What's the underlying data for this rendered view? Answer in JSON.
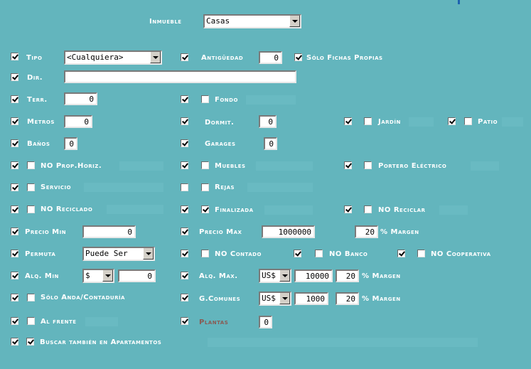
{
  "header": {
    "inmueble_label": "Inmueble",
    "inmueble_value": "Casas"
  },
  "tipo": {
    "label": "Tipo",
    "value": "<Cualquiera>"
  },
  "antiguedad": {
    "label": "Antigüedad",
    "value": "0"
  },
  "solo_fichas": {
    "label": "Sólo Fichas Propias"
  },
  "dir": {
    "label": "Dir.",
    "value": ""
  },
  "terr": {
    "label": "Terr.",
    "value": "0"
  },
  "fondo": {
    "label": "Fondo"
  },
  "metros": {
    "label": "Metros",
    "value": "0"
  },
  "dormit": {
    "label": "Dormit.",
    "value": "0"
  },
  "jardin": {
    "label": "Jardín"
  },
  "patio": {
    "label": "Patio"
  },
  "banos": {
    "label": "Baños",
    "value": "0"
  },
  "garages": {
    "label": "Garages",
    "value": "0"
  },
  "no_prop_horiz": {
    "label": "NO Prop.Horiz."
  },
  "muebles": {
    "label": "Muebles"
  },
  "portero": {
    "label": "Portero Eléctrico"
  },
  "servicio": {
    "label": "Servicio"
  },
  "rejas": {
    "label": "Rejas"
  },
  "no_reciclado": {
    "label": "NO Reciclado"
  },
  "finalizada": {
    "label": "Finalizada"
  },
  "no_reciclar": {
    "label": "NO Reciclar"
  },
  "precio_min": {
    "label": "Precio Min",
    "value": "0"
  },
  "precio_max": {
    "label": "Precio Max",
    "value": "1000000",
    "margen_value": "20",
    "margen_label": "% Margen"
  },
  "permuta": {
    "label": "Permuta",
    "value": "Puede Ser"
  },
  "no_contado": {
    "label": "NO Contado"
  },
  "no_banco": {
    "label": "NO Banco"
  },
  "no_cooperativa": {
    "label": "NO Cooperativa"
  },
  "alq_min": {
    "label": "Alq. Min",
    "currency": "$",
    "value": "0"
  },
  "alq_max": {
    "label": "Alq. Max.",
    "currency": "US$",
    "value": "10000",
    "margen_value": "20",
    "margen_label": "% Margen"
  },
  "solo_anda": {
    "label": "Sólo Anda/Contaduría"
  },
  "g_comunes": {
    "label": "G.Comunes",
    "currency": "US$",
    "value": "1000",
    "margen_value": "20",
    "margen_label": "% Margen"
  },
  "al_frente": {
    "label": "Al frente"
  },
  "plantas": {
    "label": "Plantas",
    "value": "0"
  },
  "buscar_apartamentos": {
    "label": "Buscar también en Apartamentos"
  },
  "colors": {
    "background": "#63b5bd",
    "label": "#ffffff",
    "disabled_label": "#8a5a52"
  }
}
